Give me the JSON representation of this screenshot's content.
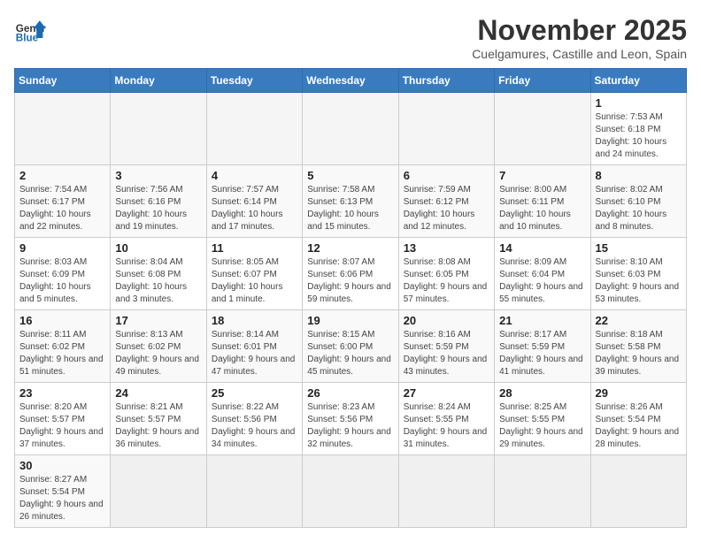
{
  "logo": {
    "text_general": "General",
    "text_blue": "Blue"
  },
  "header": {
    "month": "November 2025",
    "location": "Cuelgamures, Castille and Leon, Spain"
  },
  "weekdays": [
    "Sunday",
    "Monday",
    "Tuesday",
    "Wednesday",
    "Thursday",
    "Friday",
    "Saturday"
  ],
  "days": [
    {
      "num": "",
      "info": ""
    },
    {
      "num": "",
      "info": ""
    },
    {
      "num": "",
      "info": ""
    },
    {
      "num": "",
      "info": ""
    },
    {
      "num": "",
      "info": ""
    },
    {
      "num": "",
      "info": ""
    },
    {
      "num": "1",
      "info": "Sunrise: 7:53 AM\nSunset: 6:18 PM\nDaylight: 10 hours and 24 minutes."
    },
    {
      "num": "2",
      "info": "Sunrise: 7:54 AM\nSunset: 6:17 PM\nDaylight: 10 hours and 22 minutes."
    },
    {
      "num": "3",
      "info": "Sunrise: 7:56 AM\nSunset: 6:16 PM\nDaylight: 10 hours and 19 minutes."
    },
    {
      "num": "4",
      "info": "Sunrise: 7:57 AM\nSunset: 6:14 PM\nDaylight: 10 hours and 17 minutes."
    },
    {
      "num": "5",
      "info": "Sunrise: 7:58 AM\nSunset: 6:13 PM\nDaylight: 10 hours and 15 minutes."
    },
    {
      "num": "6",
      "info": "Sunrise: 7:59 AM\nSunset: 6:12 PM\nDaylight: 10 hours and 12 minutes."
    },
    {
      "num": "7",
      "info": "Sunrise: 8:00 AM\nSunset: 6:11 PM\nDaylight: 10 hours and 10 minutes."
    },
    {
      "num": "8",
      "info": "Sunrise: 8:02 AM\nSunset: 6:10 PM\nDaylight: 10 hours and 8 minutes."
    },
    {
      "num": "9",
      "info": "Sunrise: 8:03 AM\nSunset: 6:09 PM\nDaylight: 10 hours and 5 minutes."
    },
    {
      "num": "10",
      "info": "Sunrise: 8:04 AM\nSunset: 6:08 PM\nDaylight: 10 hours and 3 minutes."
    },
    {
      "num": "11",
      "info": "Sunrise: 8:05 AM\nSunset: 6:07 PM\nDaylight: 10 hours and 1 minute."
    },
    {
      "num": "12",
      "info": "Sunrise: 8:07 AM\nSunset: 6:06 PM\nDaylight: 9 hours and 59 minutes."
    },
    {
      "num": "13",
      "info": "Sunrise: 8:08 AM\nSunset: 6:05 PM\nDaylight: 9 hours and 57 minutes."
    },
    {
      "num": "14",
      "info": "Sunrise: 8:09 AM\nSunset: 6:04 PM\nDaylight: 9 hours and 55 minutes."
    },
    {
      "num": "15",
      "info": "Sunrise: 8:10 AM\nSunset: 6:03 PM\nDaylight: 9 hours and 53 minutes."
    },
    {
      "num": "16",
      "info": "Sunrise: 8:11 AM\nSunset: 6:02 PM\nDaylight: 9 hours and 51 minutes."
    },
    {
      "num": "17",
      "info": "Sunrise: 8:13 AM\nSunset: 6:02 PM\nDaylight: 9 hours and 49 minutes."
    },
    {
      "num": "18",
      "info": "Sunrise: 8:14 AM\nSunset: 6:01 PM\nDaylight: 9 hours and 47 minutes."
    },
    {
      "num": "19",
      "info": "Sunrise: 8:15 AM\nSunset: 6:00 PM\nDaylight: 9 hours and 45 minutes."
    },
    {
      "num": "20",
      "info": "Sunrise: 8:16 AM\nSunset: 5:59 PM\nDaylight: 9 hours and 43 minutes."
    },
    {
      "num": "21",
      "info": "Sunrise: 8:17 AM\nSunset: 5:59 PM\nDaylight: 9 hours and 41 minutes."
    },
    {
      "num": "22",
      "info": "Sunrise: 8:18 AM\nSunset: 5:58 PM\nDaylight: 9 hours and 39 minutes."
    },
    {
      "num": "23",
      "info": "Sunrise: 8:20 AM\nSunset: 5:57 PM\nDaylight: 9 hours and 37 minutes."
    },
    {
      "num": "24",
      "info": "Sunrise: 8:21 AM\nSunset: 5:57 PM\nDaylight: 9 hours and 36 minutes."
    },
    {
      "num": "25",
      "info": "Sunrise: 8:22 AM\nSunset: 5:56 PM\nDaylight: 9 hours and 34 minutes."
    },
    {
      "num": "26",
      "info": "Sunrise: 8:23 AM\nSunset: 5:56 PM\nDaylight: 9 hours and 32 minutes."
    },
    {
      "num": "27",
      "info": "Sunrise: 8:24 AM\nSunset: 5:55 PM\nDaylight: 9 hours and 31 minutes."
    },
    {
      "num": "28",
      "info": "Sunrise: 8:25 AM\nSunset: 5:55 PM\nDaylight: 9 hours and 29 minutes."
    },
    {
      "num": "29",
      "info": "Sunrise: 8:26 AM\nSunset: 5:54 PM\nDaylight: 9 hours and 28 minutes."
    },
    {
      "num": "30",
      "info": "Sunrise: 8:27 AM\nSunset: 5:54 PM\nDaylight: 9 hours and 26 minutes."
    },
    {
      "num": "",
      "info": ""
    },
    {
      "num": "",
      "info": ""
    },
    {
      "num": "",
      "info": ""
    },
    {
      "num": "",
      "info": ""
    },
    {
      "num": "",
      "info": ""
    },
    {
      "num": "",
      "info": ""
    },
    {
      "num": "",
      "info": ""
    }
  ]
}
